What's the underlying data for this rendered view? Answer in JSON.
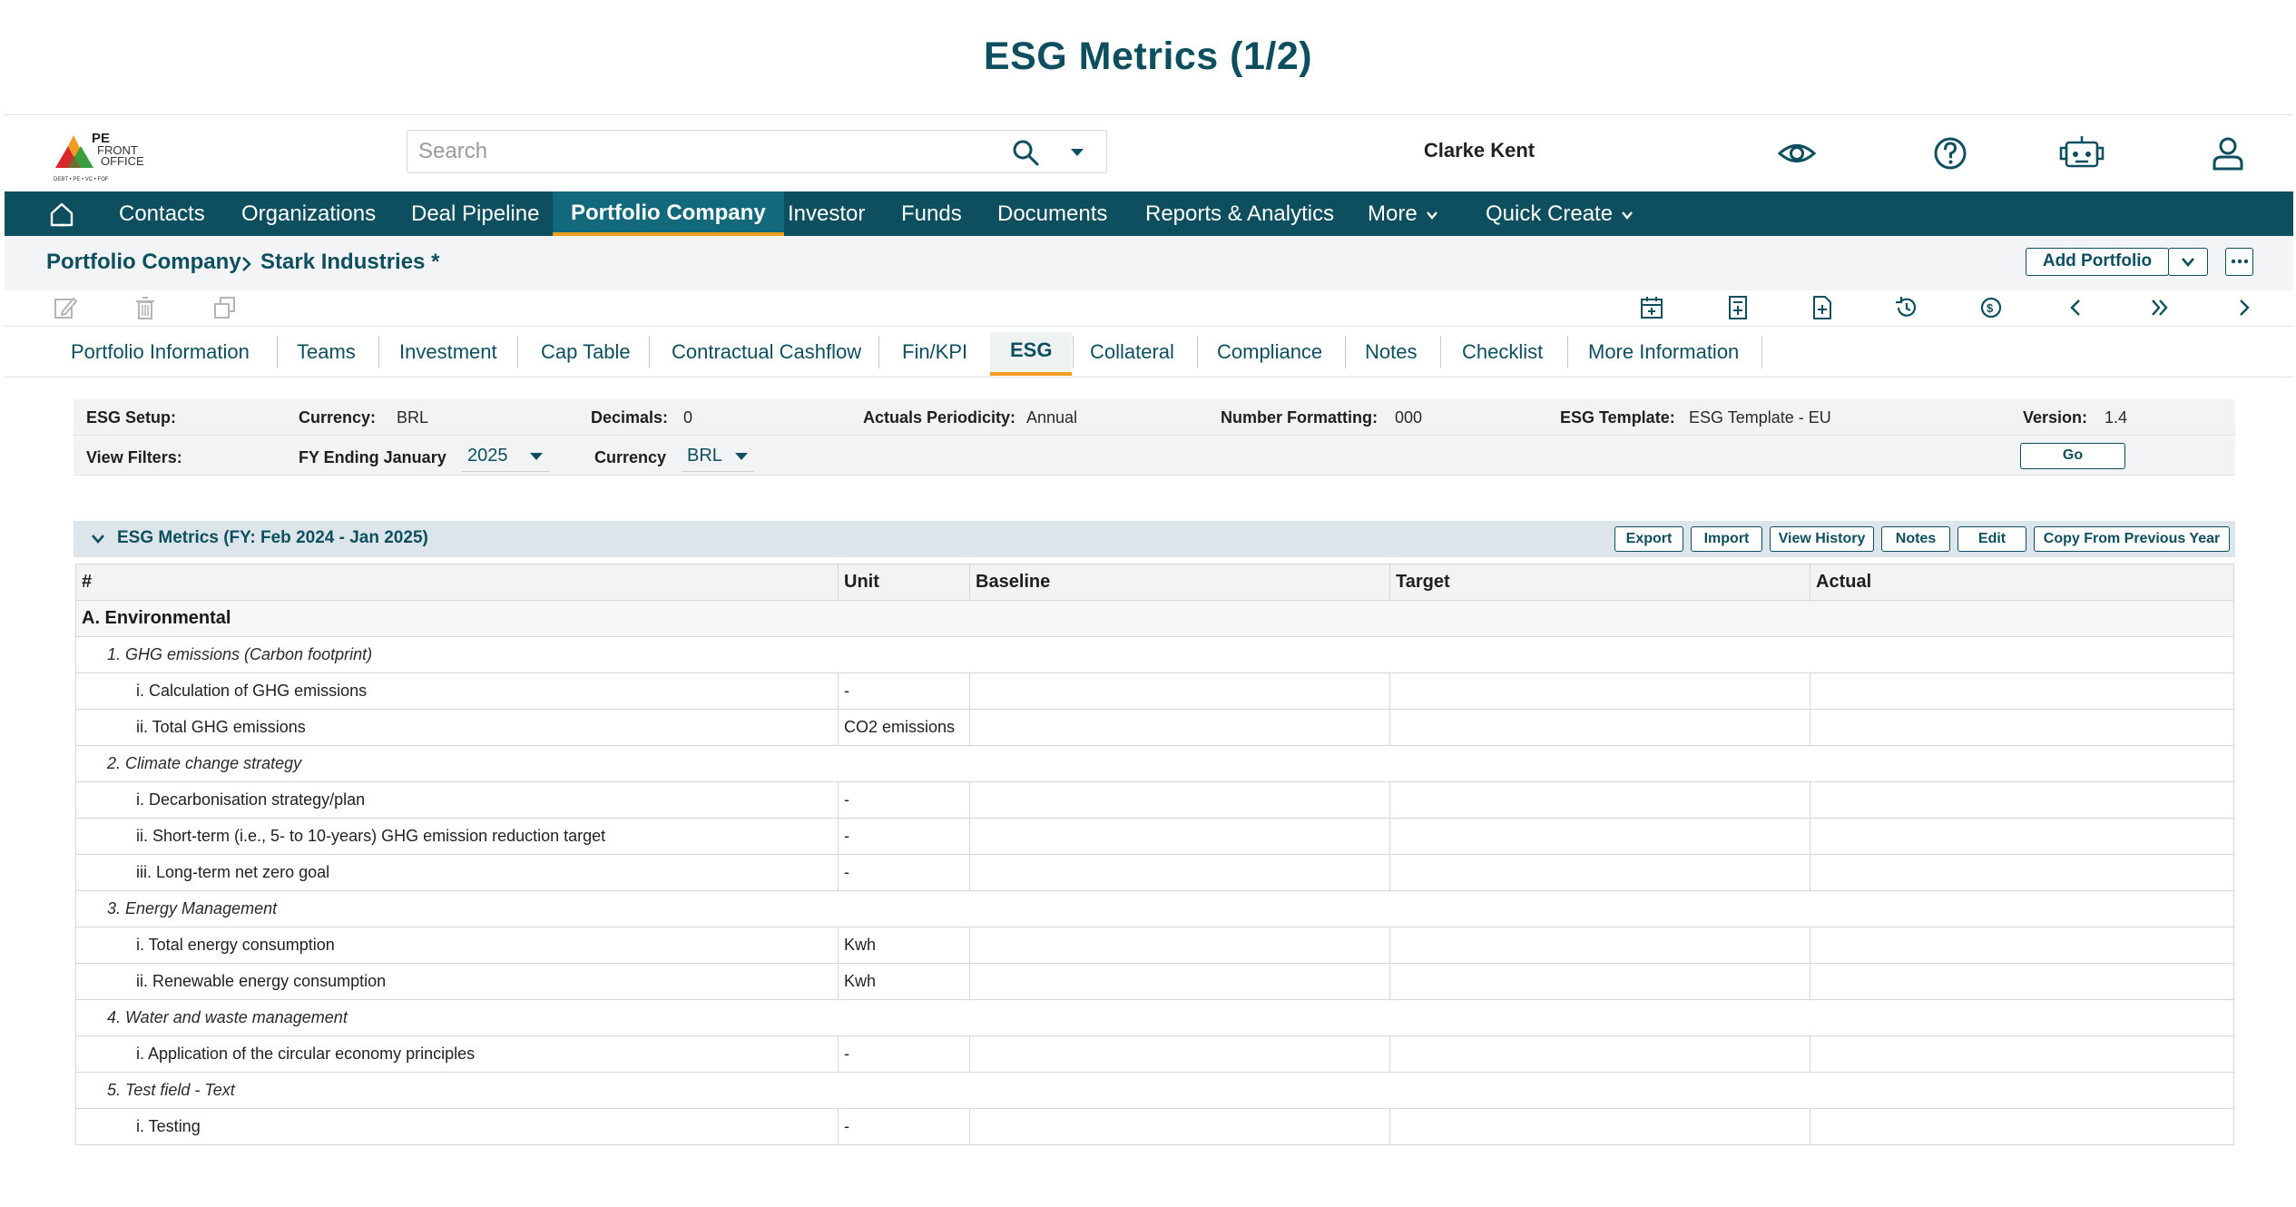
{
  "slide_title": "ESG Metrics (1/2)",
  "colors": {
    "primary": "#0d4f5f",
    "accent": "#f29c1f"
  },
  "logo": {
    "line1": "PE",
    "line2": "FRONT",
    "line3": "OFFICE",
    "tagline": "DEBT • PE • VC • FOF"
  },
  "search": {
    "placeholder": "Search"
  },
  "user": {
    "name": "Clarke Kent"
  },
  "header_icons": [
    "eye-icon",
    "help-icon",
    "robot-icon",
    "user-icon"
  ],
  "nav": {
    "items": [
      "Contacts",
      "Organizations",
      "Deal Pipeline",
      "Portfolio Company",
      "Investor",
      "Funds",
      "Documents",
      "Reports & Analytics",
      "More",
      "Quick Create"
    ],
    "active": "Portfolio Company"
  },
  "breadcrumb": {
    "parent": "Portfolio Company",
    "current": "Stark Industries *"
  },
  "actions": {
    "add_portfolio": "Add Portfolio"
  },
  "tabs": [
    "Portfolio Information",
    "Teams",
    "Investment",
    "Cap Table",
    "Contractual Cashflow",
    "Fin/KPI",
    "ESG",
    "Collateral",
    "Compliance",
    "Notes",
    "Checklist",
    "More Information"
  ],
  "active_tab": "ESG",
  "setup": {
    "label": "ESG Setup:",
    "currency_label": "Currency:",
    "currency": "BRL",
    "decimals_label": "Decimals:",
    "decimals": "0",
    "periodicity_label": "Actuals Periodicity:",
    "periodicity": "Annual",
    "formatting_label": "Number Formatting:",
    "formatting": "000",
    "template_label": "ESG Template:",
    "template": "ESG Template - EU",
    "version_label": "Version:",
    "version": "1.4"
  },
  "filters": {
    "label": "View Filters:",
    "fy_label": "FY Ending January",
    "fy_value": "2025",
    "currency_label": "Currency",
    "currency_value": "BRL",
    "go": "Go"
  },
  "section": {
    "title": "ESG Metrics (FY: Feb 2024 - Jan 2025)",
    "buttons": {
      "export": "Export",
      "import": "Import",
      "history": "View History",
      "notes": "Notes",
      "edit": "Edit",
      "copy": "Copy From Previous Year"
    }
  },
  "table": {
    "headers": {
      "num": "#",
      "unit": "Unit",
      "baseline": "Baseline",
      "target": "Target",
      "actual": "Actual"
    },
    "category": "A. Environmental",
    "groups": [
      {
        "name": "1. GHG emissions (Carbon footprint)",
        "items": [
          {
            "name": "i. Calculation of GHG emissions",
            "unit": "-"
          },
          {
            "name": "ii. Total GHG emissions",
            "unit": "CO2 emissions"
          }
        ]
      },
      {
        "name": "2. Climate change strategy",
        "items": [
          {
            "name": "i. Decarbonisation strategy/plan",
            "unit": "-"
          },
          {
            "name": "ii. Short-term (i.e., 5- to 10-years) GHG emission reduction target",
            "unit": "-"
          },
          {
            "name": "iii. Long-term net zero goal",
            "unit": "-"
          }
        ]
      },
      {
        "name": "3. Energy Management",
        "items": [
          {
            "name": "i. Total energy consumption",
            "unit": "Kwh"
          },
          {
            "name": "ii. Renewable energy consumption",
            "unit": "Kwh"
          }
        ]
      },
      {
        "name": "4. Water and waste management",
        "items": [
          {
            "name": "i. Application of the circular economy principles",
            "unit": "-"
          }
        ]
      },
      {
        "name": "5. Test field - Text",
        "items": [
          {
            "name": "i. Testing",
            "unit": "-"
          }
        ]
      }
    ]
  }
}
